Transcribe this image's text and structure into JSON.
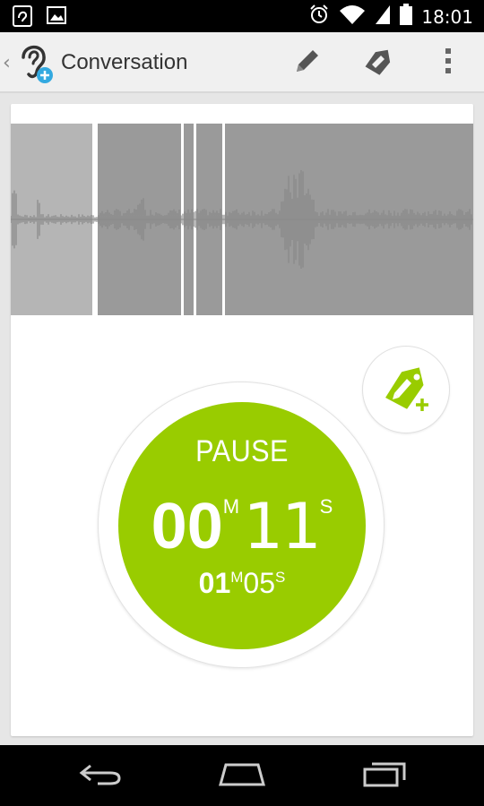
{
  "status_bar": {
    "time": "18:01",
    "icons": [
      "app-notification-icon",
      "image-notification-icon",
      "alarm-icon",
      "wifi-icon",
      "cell-signal-icon",
      "battery-icon"
    ]
  },
  "action_bar": {
    "title": "Conversation",
    "up_glyph": "‹",
    "actions": [
      "pencil-icon",
      "edit-tag-icon",
      "overflow-menu-icon"
    ]
  },
  "recorder": {
    "state_label": "PAUSE",
    "elapsed": {
      "minutes": "00",
      "minutes_unit": "M",
      "seconds": "11",
      "seconds_unit": "S"
    },
    "total": {
      "minutes": "01",
      "minutes_unit": "M",
      "seconds": "05",
      "seconds_unit": "S"
    }
  },
  "colors": {
    "accent": "#99cc00",
    "waveform_bg": "#9a9a9a",
    "waveform_highlight": "#b5b5b5",
    "action_bar_bg": "#f0f0f0"
  }
}
